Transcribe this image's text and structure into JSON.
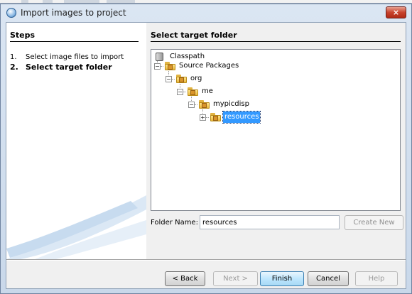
{
  "window": {
    "title": "Import images to project",
    "close_label": "×"
  },
  "steps": {
    "heading": "Steps",
    "items": [
      {
        "num": "1.",
        "label": "Select image files to import",
        "current": false
      },
      {
        "num": "2.",
        "label": "Select target folder",
        "current": true
      }
    ]
  },
  "main": {
    "heading": "Select target folder"
  },
  "tree": {
    "nodes": [
      {
        "label": "Classpath",
        "icon": "jar-icon"
      },
      {
        "label": "Source Packages",
        "icon": "folder-icon",
        "expander": "minus"
      },
      {
        "label": "org",
        "icon": "package-folder-icon",
        "expander": "minus"
      },
      {
        "label": "me",
        "icon": "package-folder-icon",
        "expander": "minus"
      },
      {
        "label": "mypicdisp",
        "icon": "package-folder-icon",
        "expander": "minus"
      },
      {
        "label": "resources",
        "icon": "package-folder-icon",
        "expander": "plus",
        "selected": true
      }
    ]
  },
  "folder_name": {
    "label": "Folder Name:",
    "value": "resources"
  },
  "buttons": {
    "create_new": "Create New",
    "back": "< Back",
    "next": "Next >",
    "finish": "Finish",
    "cancel": "Cancel",
    "help": "Help"
  },
  "colors": {
    "selection": "#3399ff",
    "close": "#c8432d"
  }
}
